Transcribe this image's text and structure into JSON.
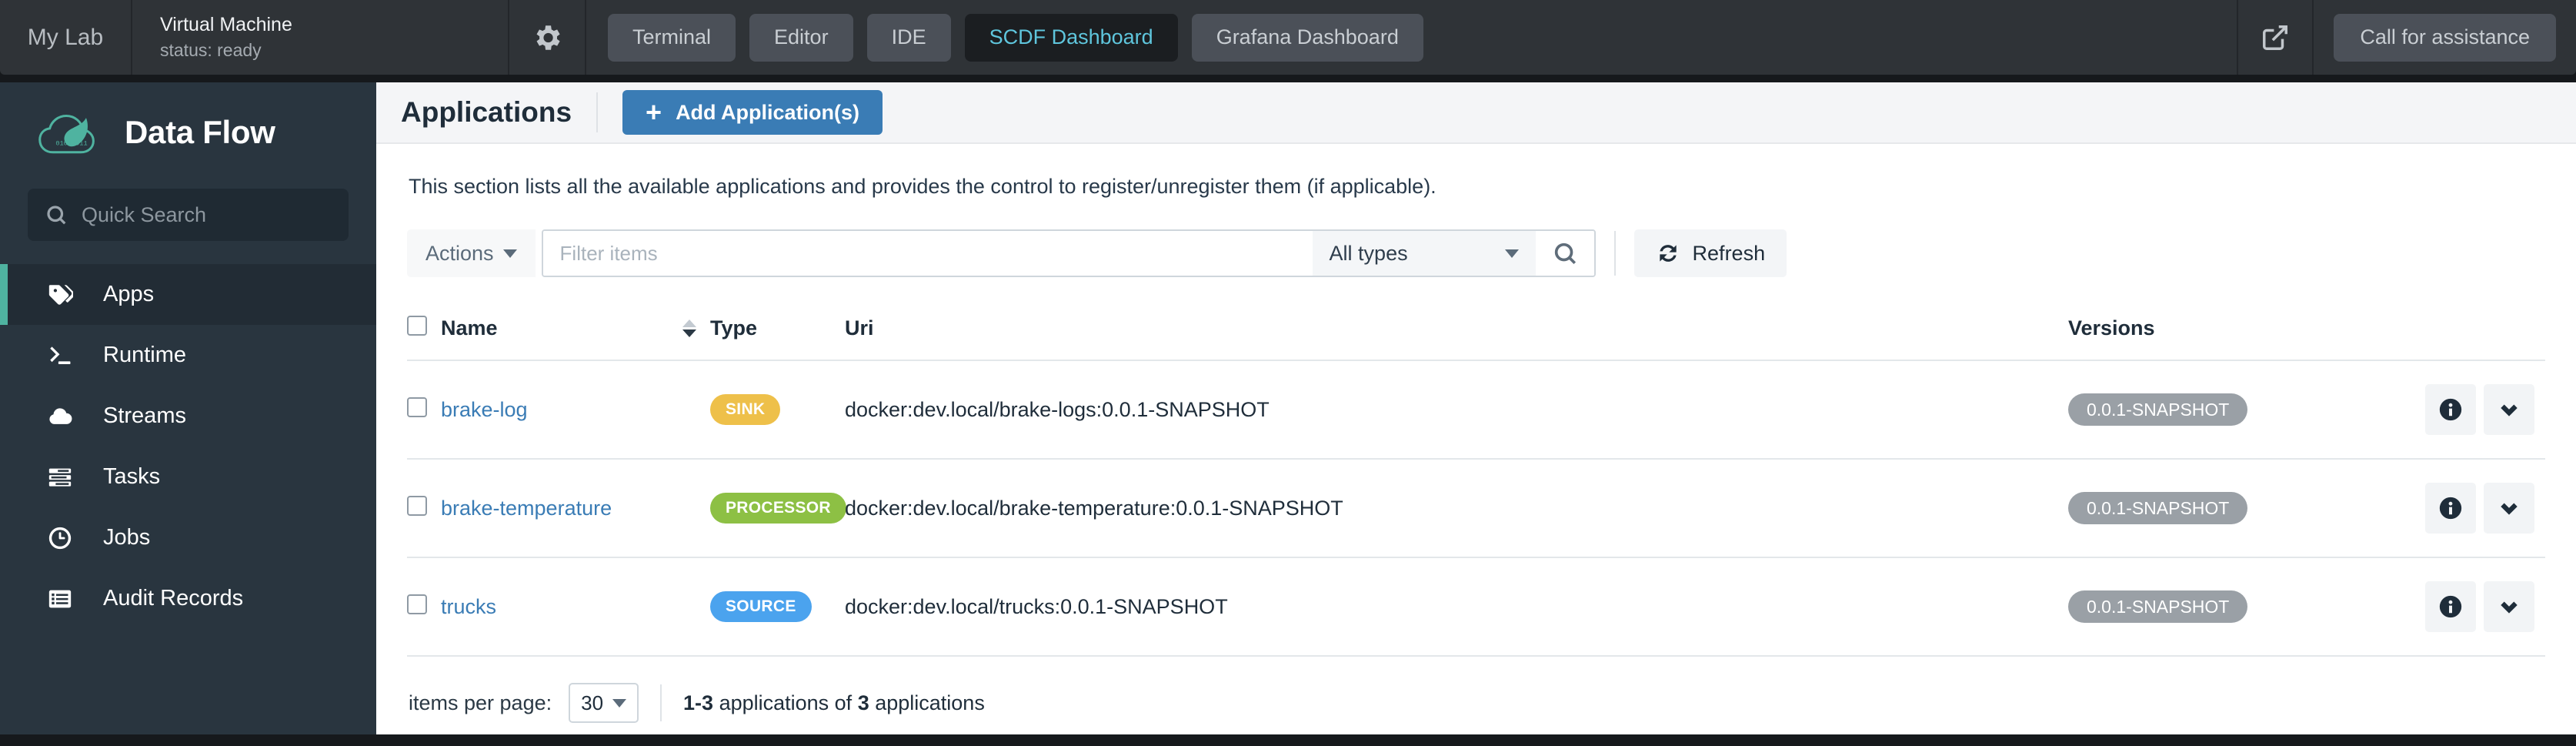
{
  "lab_bar": {
    "title": "My Lab",
    "vm_name": "Virtual Machine",
    "vm_status": "status: ready",
    "gear_icon": "gear-icon",
    "tabs": [
      {
        "label": "Terminal",
        "active": false
      },
      {
        "label": "Editor",
        "active": false
      },
      {
        "label": "IDE",
        "active": false
      },
      {
        "label": "SCDF Dashboard",
        "active": true
      },
      {
        "label": "Grafana Dashboard",
        "active": false
      }
    ],
    "external_link_icon": "external-link-icon",
    "assistance_label": "Call for assistance",
    "active_tab_color": "#5fc6dd"
  },
  "sidebar": {
    "brand": "Data Flow",
    "logo_icon": "spring-cloud-dataflow-logo",
    "search": {
      "placeholder": "Quick Search",
      "value": ""
    },
    "accent_color": "#4fb3a0",
    "items": [
      {
        "label": "Apps",
        "icon": "tag-icon",
        "active": true
      },
      {
        "label": "Runtime",
        "icon": "terminal-prompt-icon",
        "active": false
      },
      {
        "label": "Streams",
        "icon": "cloud-icon",
        "active": false
      },
      {
        "label": "Tasks",
        "icon": "tasks-icon",
        "active": false
      },
      {
        "label": "Jobs",
        "icon": "clock-icon",
        "active": false
      },
      {
        "label": "Audit Records",
        "icon": "list-records-icon",
        "active": false
      }
    ]
  },
  "page": {
    "title": "Applications",
    "add_button": {
      "label": "Add Application(s)",
      "icon": "plus-icon",
      "color": "#3a7cb5"
    },
    "description": "This section lists all the available applications and provides the control to register/unregister them (if applicable)."
  },
  "toolbar": {
    "actions_label": "Actions",
    "filter_placeholder": "Filter items",
    "filter_value": "",
    "type_selected": "All types",
    "search_icon": "search-icon",
    "refresh_label": "Refresh",
    "refresh_icon": "refresh-icon"
  },
  "table": {
    "columns": {
      "name": "Name",
      "type": "Type",
      "uri": "Uri",
      "versions": "Versions"
    },
    "sort": {
      "column": "Name",
      "direction": "desc"
    },
    "rows": [
      {
        "name": "brake-log",
        "type": "SINK",
        "type_color": "#eec04a",
        "uri": "docker:dev.local/brake-logs:0.0.1-SNAPSHOT",
        "version": "0.0.1-SNAPSHOT",
        "checked": false
      },
      {
        "name": "brake-temperature",
        "type": "PROCESSOR",
        "type_color": "#8dc044",
        "uri": "docker:dev.local/brake-temperature:0.0.1-SNAPSHOT",
        "version": "0.0.1-SNAPSHOT",
        "checked": false
      },
      {
        "name": "trucks",
        "type": "SOURCE",
        "type_color": "#4ba3ee",
        "uri": "docker:dev.local/trucks:0.0.1-SNAPSHOT",
        "version": "0.0.1-SNAPSHOT",
        "checked": false
      }
    ],
    "row_actions": {
      "info_icon": "info-icon",
      "expand_icon": "chevron-down-icon"
    }
  },
  "pager": {
    "label": "items per page:",
    "per_page": "30",
    "range": "1-3",
    "range_suffix": " applications of ",
    "total": "3",
    "total_suffix": " applications"
  }
}
